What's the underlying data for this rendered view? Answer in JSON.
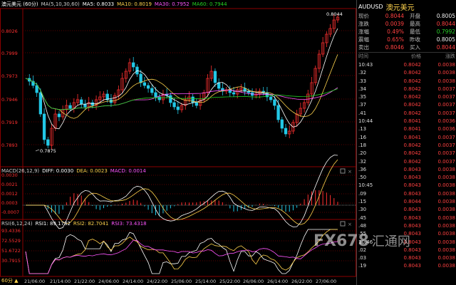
{
  "main_header": {
    "title": "澳元美元 (60分)",
    "ma_label": "MA(5,10,30,60)",
    "ma5": "MA5: 0.8033",
    "ma10": "MA10: 0.8019",
    "ma30": "MA30: 0.7952",
    "ma60": "MA60: 0.7944"
  },
  "main_axis_labels": [
    "0.8026",
    "0.7999",
    "0.7973",
    "0.7946",
    "0.7919",
    "0.7893"
  ],
  "main_annotations": {
    "high": "0.8044",
    "low": "0.7875"
  },
  "macd_header": {
    "title": "MACD(26,12,9)",
    "diff": "DIFF: 0.0030",
    "dea": "DEA: 0.0023",
    "macd": "MACD: 0.0014"
  },
  "macd_axis_labels": [
    "0.0030",
    "0.0021",
    "0.0012",
    "0.0003",
    "-0.0007"
  ],
  "rsi_header": {
    "title": "RSI(6,12,24)",
    "rsi1": "RSI1: 89.1782",
    "rsi2": "RSI2: 82.7041",
    "rsi3": "RSI3: 73.4318"
  },
  "rsi_axis_labels": [
    "93.4336",
    "72.5529",
    "51.6722",
    "30.7915"
  ],
  "time_labels": [
    "21/06:00",
    "21/14:00",
    "21/22:00",
    "24/06:00",
    "24/14:00",
    "24/22:00",
    "25/06:00",
    "25/14:00",
    "25/22:00",
    "26/06:00",
    "26/14:00",
    "26/22:00",
    "27/06:00"
  ],
  "period_label": "60分 ▲",
  "symbol": {
    "code": "AUDUSD",
    "name": "澳元美元"
  },
  "quote": [
    {
      "l1": "现价",
      "v1": "0.8044",
      "c1": "red",
      "l2": "开盘",
      "v2": "0.8005",
      "c2": "wht"
    },
    {
      "l1": "涨跌",
      "v1": "0.0039",
      "c1": "red",
      "l2": "最高",
      "v2": "0.8044",
      "c2": "red"
    },
    {
      "l1": "涨幅",
      "v1": "0.49%",
      "c1": "red",
      "l2": "最低",
      "v2": "0.7992",
      "c2": "grn"
    },
    {
      "l1": "震幅",
      "v1": "0.65%",
      "c1": "red",
      "l2": "昨收",
      "v2": "0.8005",
      "c2": "wht"
    },
    {
      "l1": "卖出",
      "v1": "0.8046",
      "c1": "red",
      "l2": "买入",
      "v2": "0.8044",
      "c2": "red"
    }
  ],
  "tick_head": {
    "time": "时间",
    "price": "价格",
    "change": "涨跌"
  },
  "ticks": [
    {
      "t": "10:43",
      "p": "0.8042",
      "c": "0.0038"
    },
    {
      "t": ".32",
      "p": "0.8042",
      "c": "0.0038"
    },
    {
      "t": ".33",
      "p": "0.8042",
      "c": "0.0038"
    },
    {
      "t": ".34",
      "p": "0.8042",
      "c": "0.0037"
    },
    {
      "t": ".35",
      "p": "0.8042",
      "c": "0.0037"
    },
    {
      "t": ".37",
      "p": "0.8042",
      "c": "0.0037"
    },
    {
      "t": ".41",
      "p": "0.8042",
      "c": "0.0037"
    },
    {
      "t": "10:44",
      "p": "0.8041",
      "c": "0.0036"
    },
    {
      "t": ".13",
      "p": "0.8041",
      "c": "0.0036"
    },
    {
      "t": ".16",
      "p": "0.8041",
      "c": "0.0037"
    },
    {
      "t": ".18",
      "p": "0.8042",
      "c": "0.0037"
    },
    {
      "t": ".20",
      "p": "0.8042",
      "c": "0.0037"
    },
    {
      "t": ".32",
      "p": "0.8042",
      "c": "0.0037"
    },
    {
      "t": ".36",
      "p": "0.8043",
      "c": "0.0038"
    },
    {
      "t": ".50",
      "p": "0.8043",
      "c": "0.0038"
    },
    {
      "t": "10:45",
      "p": "0.8043",
      "c": "0.0038"
    },
    {
      "t": ".09",
      "p": "0.8043",
      "c": "0.0038"
    },
    {
      "t": ".15",
      "p": "0.8044",
      "c": "0.0038"
    },
    {
      "t": ".30",
      "p": "0.8043",
      "c": "0.0038"
    },
    {
      "t": ".45",
      "p": "0.8043",
      "c": "0.0038"
    },
    {
      "t": ".48",
      "p": "0.8043",
      "c": "0.0038"
    },
    {
      "t": ".55",
      "p": "0.8043",
      "c": "0.0038"
    },
    {
      "t": "10:46",
      "p": "0.8043",
      "c": "0.0038"
    },
    {
      "t": ".02",
      "p": "0.8043",
      "c": "0.0038"
    },
    {
      "t": ".03",
      "p": "0.8043",
      "c": "0.0038"
    },
    {
      "t": ".19",
      "p": "0.8043",
      "c": "0.0038"
    }
  ],
  "watermark": {
    "logo": "FX678",
    "sub": "汇通网"
  },
  "colors": {
    "up": "#ff3030",
    "down": "#22c8e6",
    "ma5": "#ffffff",
    "ma10": "#ffd34d",
    "ma30": "#ff55ff",
    "ma60": "#22d322",
    "grid": "#7a0000"
  }
}
